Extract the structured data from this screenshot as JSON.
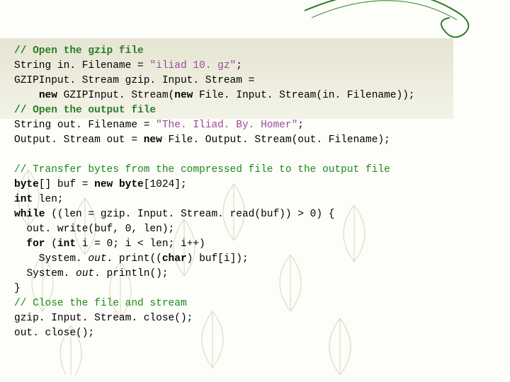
{
  "code": {
    "l01": "// Open the gzip file",
    "l02a": "String in. Filename = ",
    "l02b": "\"iliad 10. gz\"",
    "l02c": ";",
    "l03": "GZIPInput. Stream gzip. Input. Stream =",
    "l04a": "    ",
    "l04b": "new",
    "l04c": " GZIPInput. Stream(",
    "l04d": "new",
    "l04e": " File. Input. Stream(in. Filename));",
    "l05": "// Open the output file",
    "l06a": "String out. Filename = ",
    "l06b": "\"The. Iliad. By. Homer\"",
    "l06c": ";",
    "l07a": "Output. Stream out = ",
    "l07b": "new",
    "l07c": " File. Output. Stream(out. Filename);",
    "l08": " ",
    "l09": "// Transfer bytes from the compressed file to the output file",
    "l10a": "byte",
    "l10b": "[] buf = ",
    "l10c": "new byte",
    "l10d": "[1024];",
    "l11a": "int",
    "l11b": " len;",
    "l12a": "while",
    "l12b": " ((len = gzip. Input. Stream. read(buf)) > 0) {",
    "l13": "  out. write(buf, 0, len);",
    "l14a": "  ",
    "l14b": "for",
    "l14c": " (",
    "l14d": "int",
    "l14e": " i = 0; i < len; i++)",
    "l15a": "    System. ",
    "l15b": "out",
    "l15c": ". print((",
    "l15d": "char",
    "l15e": ") buf[i]);",
    "l16a": "  System. ",
    "l16b": "out",
    "l16c": ". println();",
    "l17": "}",
    "l18": "// Close the file and stream",
    "l19": "gzip. Input. Stream. close();",
    "l20": "out. close();"
  }
}
